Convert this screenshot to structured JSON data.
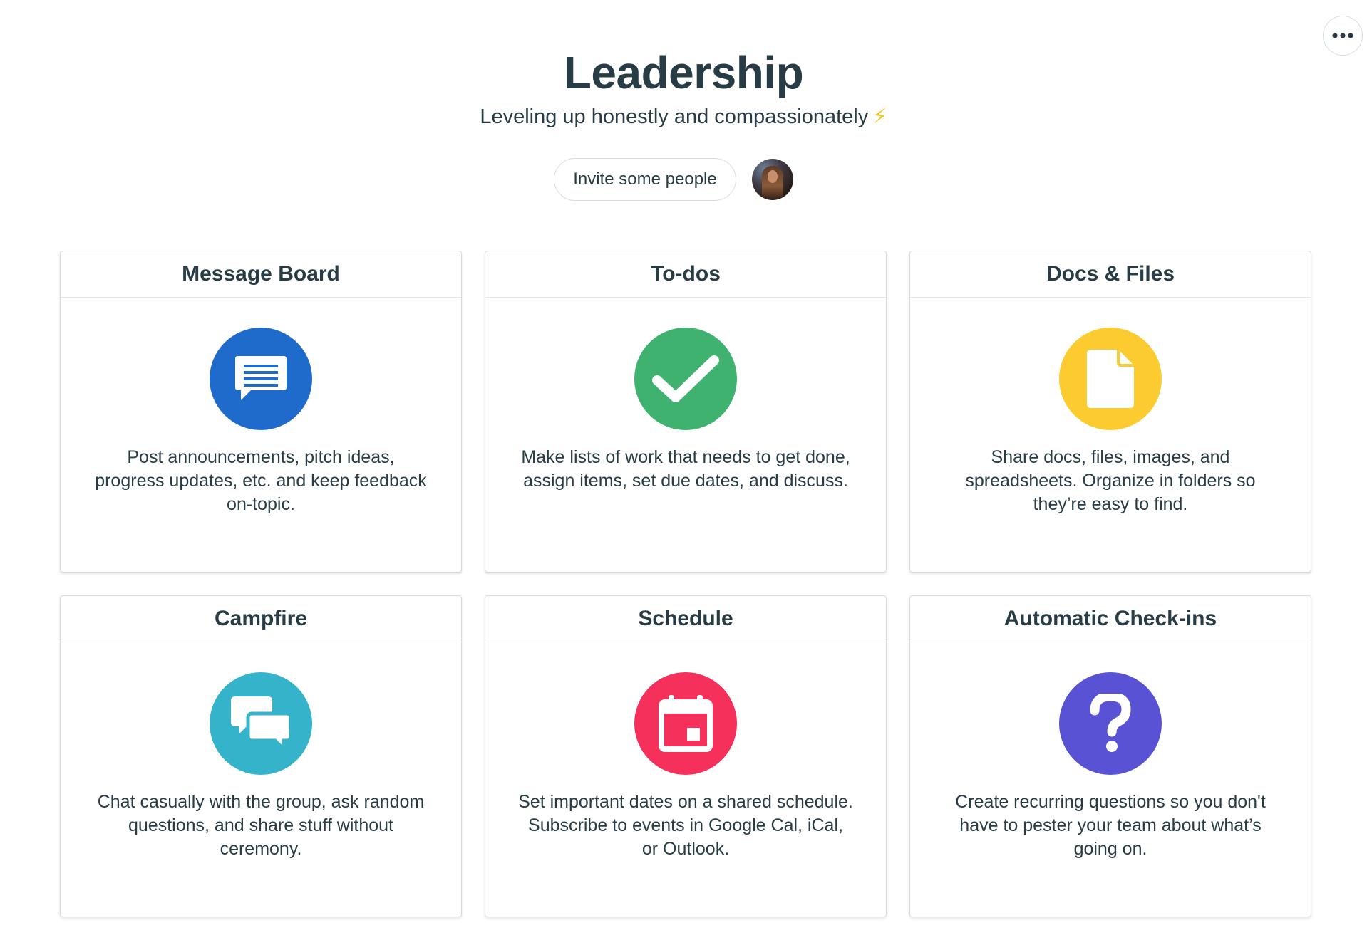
{
  "page": {
    "more_icon": "ellipsis-icon",
    "title": "Leadership",
    "subtitle": "Leveling up honestly and compassionately",
    "subtitle_emoji": "⚡",
    "invite_label": "Invite some people"
  },
  "colors": {
    "text": "#283c46",
    "message_board": "#1f6bcb",
    "todos": "#3fb26f",
    "docs_files": "#fbcb2f",
    "campfire": "#35b3cb",
    "schedule": "#f5305a",
    "checkins": "#5a52d4"
  },
  "tools": [
    {
      "title": "Message Board",
      "icon": "message-board-icon",
      "description": "Post announcements, pitch ideas, progress updates, etc. and keep feedback on-topic."
    },
    {
      "title": "To-dos",
      "icon": "checkmark-icon",
      "description": "Make lists of work that needs to get done, assign items, set due dates, and discuss."
    },
    {
      "title": "Docs & Files",
      "icon": "document-icon",
      "description": "Share docs, files, images, and spreadsheets. Organize in folders so they’re easy to find."
    },
    {
      "title": "Campfire",
      "icon": "chat-bubbles-icon",
      "description": "Chat casually with the group, ask random questions, and share stuff without ceremony."
    },
    {
      "title": "Schedule",
      "icon": "calendar-icon",
      "description": "Set important dates on a shared schedule. Subscribe to events in Google Cal, iCal, or Outlook."
    },
    {
      "title": "Automatic Check-ins",
      "icon": "question-mark-icon",
      "description": "Create recurring questions so you don't have to pester your team about what’s going on."
    }
  ]
}
